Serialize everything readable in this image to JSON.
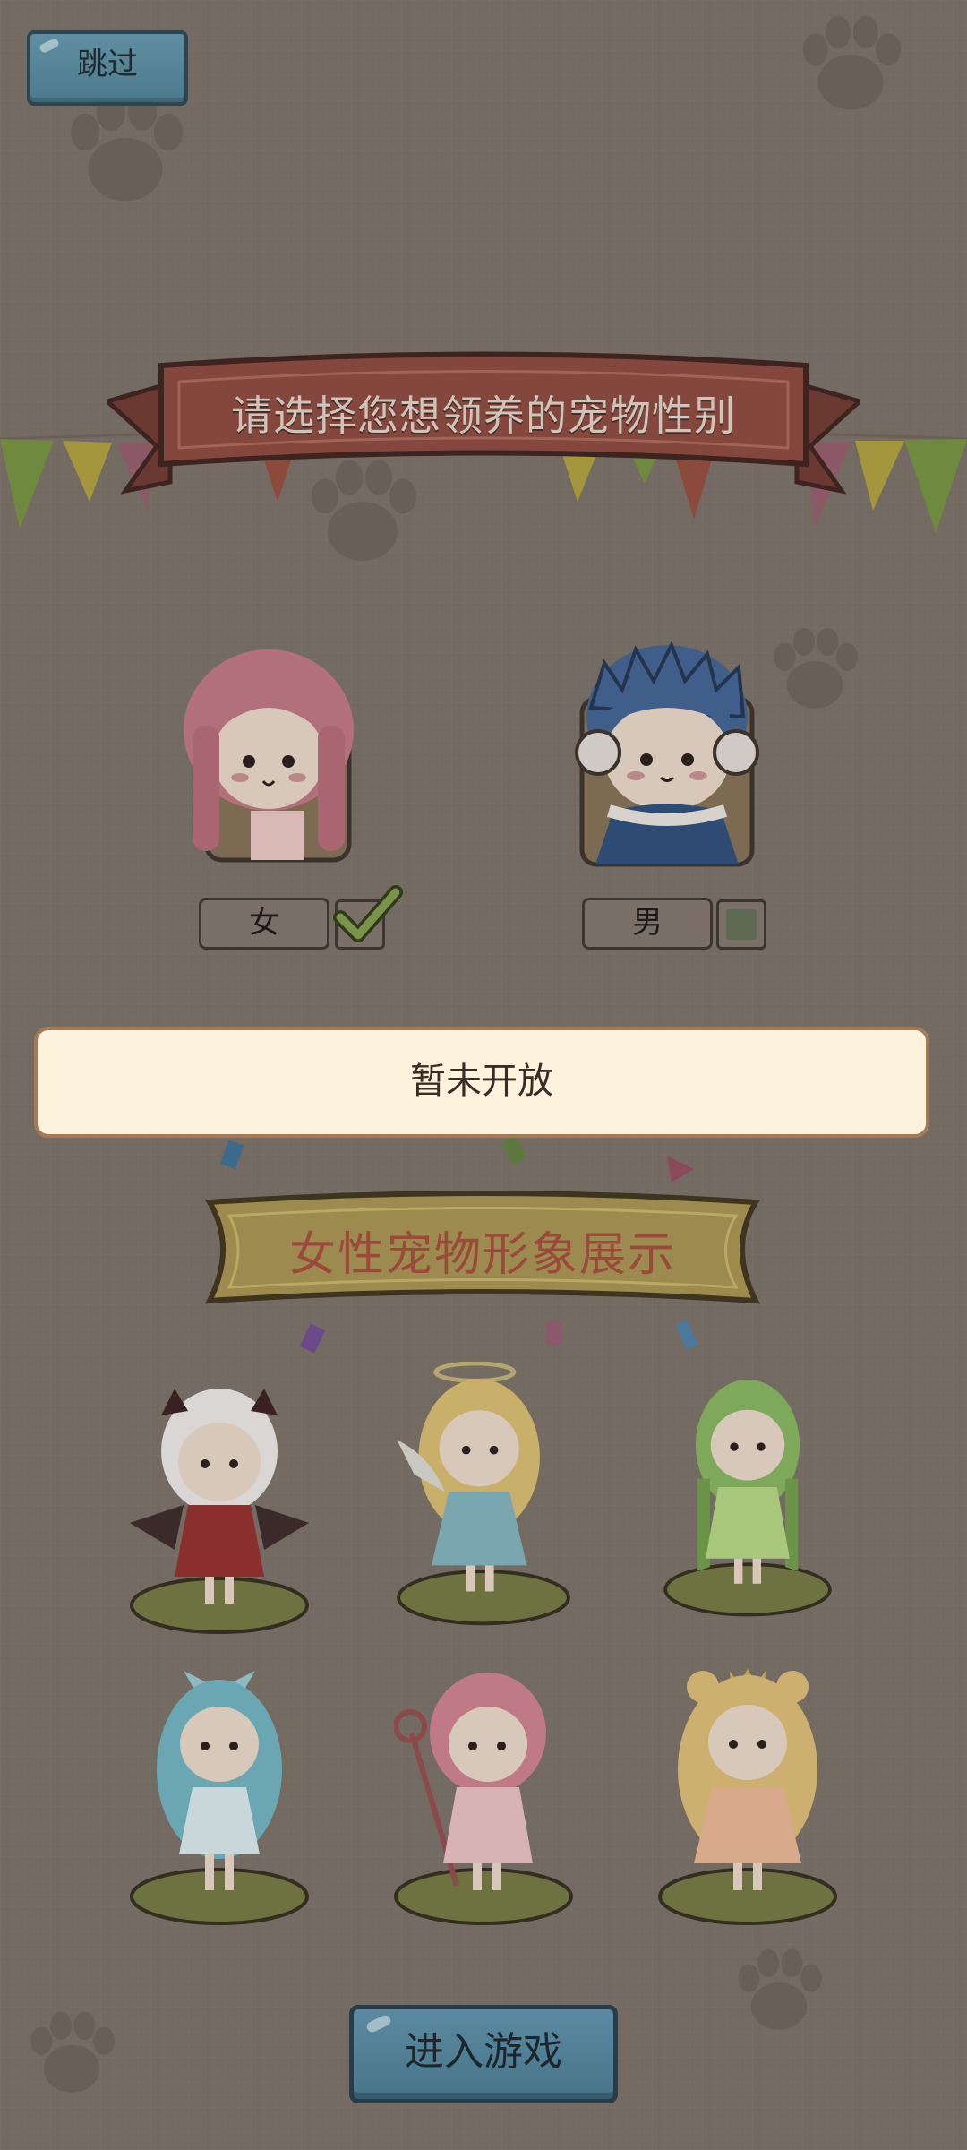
{
  "header": {
    "skip_label": "跳过"
  },
  "title_ribbon": {
    "text": "请选择您想领养的宠物性别"
  },
  "gender": {
    "female": {
      "label": "女",
      "selected": true
    },
    "male": {
      "label": "男",
      "selected": false
    }
  },
  "notice": {
    "text": "暂未开放"
  },
  "showcase": {
    "title": "女性宠物形象展示",
    "pets": [
      {
        "name": "devil-girl",
        "hair": "#d9d6d4",
        "dress": "#8a2e2e"
      },
      {
        "name": "angel-girl",
        "hair": "#c8b06a",
        "dress": "#7aa6b0"
      },
      {
        "name": "leaf-girl",
        "hair": "#7ea85a",
        "dress": "#a9c77a"
      },
      {
        "name": "ice-girl",
        "hair": "#6aa7b2",
        "dress": "#c9d7da"
      },
      {
        "name": "magic-girl",
        "hair": "#c07a86",
        "dress": "#d8b3b6"
      },
      {
        "name": "princess-girl",
        "hair": "#cdb06f",
        "dress": "#d8a98a"
      }
    ]
  },
  "footer": {
    "enter_label": "进入游戏"
  },
  "colors": {
    "overlay_bg": "#736a62",
    "banner_bg": "#fdf2dc",
    "button_blue": "#4d7b8e"
  }
}
